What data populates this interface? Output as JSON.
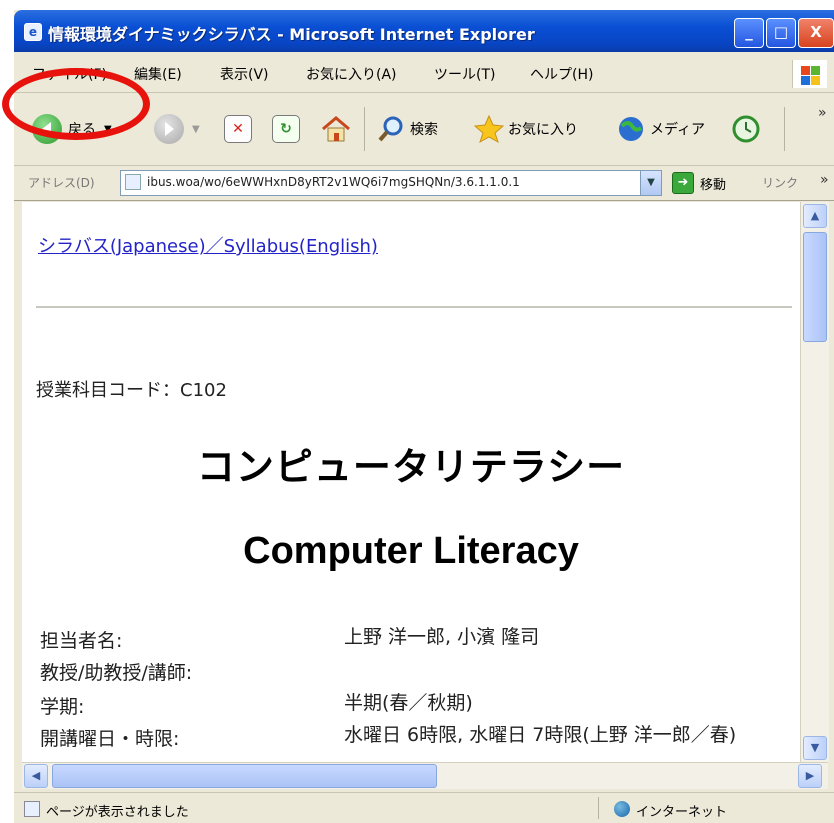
{
  "window": {
    "title": "情報環境ダイナミックシラバス - Microsoft Internet Explorer",
    "min_glyph": "_",
    "max_glyph": "□",
    "close_glyph": "X"
  },
  "menu": {
    "items": [
      "ファイル(F)",
      "編集(E)",
      "表示(V)",
      "お気に入り(A)",
      "ツール(T)",
      "ヘルプ(H)"
    ]
  },
  "toolbar": {
    "back_label": "戻る",
    "search_label": "検索",
    "favorites_label": "お気に入り",
    "media_label": "メディア",
    "more": "»"
  },
  "address": {
    "label": "アドレス(D)",
    "url": "ibus.woa/wo/6eWWHxnD8yRT2v1WQ6i7mgSHQNn/3.6.1.1.0.1",
    "go_label": "移動",
    "links_label": "リンク",
    "more": "»"
  },
  "content": {
    "syllabus_link": "シラバス(Japanese)／Syllabus(English)",
    "course_code_line": "授業科目コード：C102",
    "title_jp": "コンピュータリテラシー",
    "title_en": "Computer Literacy",
    "info": [
      {
        "label": "担当者名:",
        "value": "上野 洋一郎, 小濱 隆司"
      },
      {
        "label": "教授/助教授/講師:",
        "value": ""
      },
      {
        "label": "学期:",
        "value": "半期(春／秋期)"
      },
      {
        "label": "開講曜日・時限:",
        "value": "水曜日 6時限, 水曜日 7時限(上野 洋一郎／春)"
      }
    ]
  },
  "status": {
    "text": "ページが表示されました",
    "zone": "インターネット"
  },
  "colors": {
    "titlebar": "#0a4fd4",
    "link": "#2323c8",
    "annotation": "#e8120c"
  }
}
